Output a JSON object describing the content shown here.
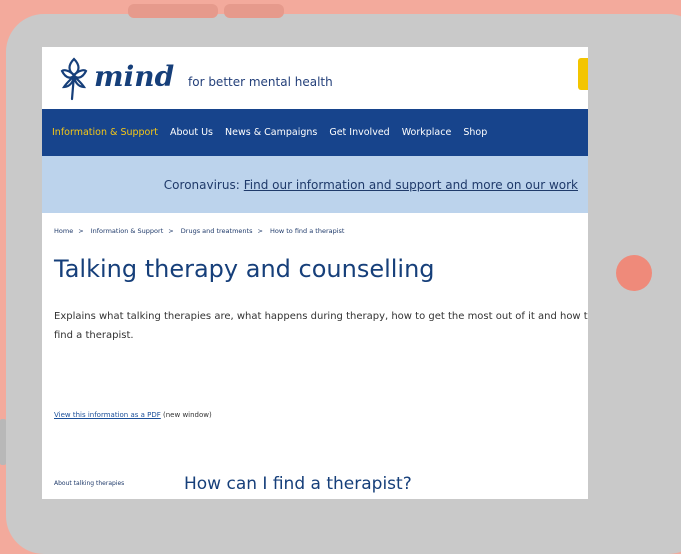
{
  "header": {
    "logo_text": "mind",
    "tagline": "for better mental health"
  },
  "nav": {
    "items": [
      "Information & Support",
      "About Us",
      "News & Campaigns",
      "Get Involved",
      "Workplace",
      "Shop"
    ],
    "active_index": 0
  },
  "banner": {
    "label": "Coronavirus:",
    "link": "Find our information and support and more on our work"
  },
  "breadcrumb": [
    "Home",
    "Information & Support",
    "Drugs and treatments",
    "How to find a therapist"
  ],
  "page": {
    "title": "Talking therapy and counselling",
    "intro": "Explains what talking therapies are, what happens during therapy, how to get the most out of it and how to find a therapist.",
    "pdf_link": "View this information as a PDF",
    "pdf_note": "(new window)",
    "side_label": "About talking therapies",
    "section_heading": "How can I find a therapist?"
  },
  "colors": {
    "background": "#f3aa9c",
    "device": "#c9c9c9",
    "nav": "#17448c",
    "nav_active": "#f6c816",
    "banner": "#bcd3ec",
    "home_button": "#ef8a7a",
    "accent_yellow": "#f3c500"
  }
}
